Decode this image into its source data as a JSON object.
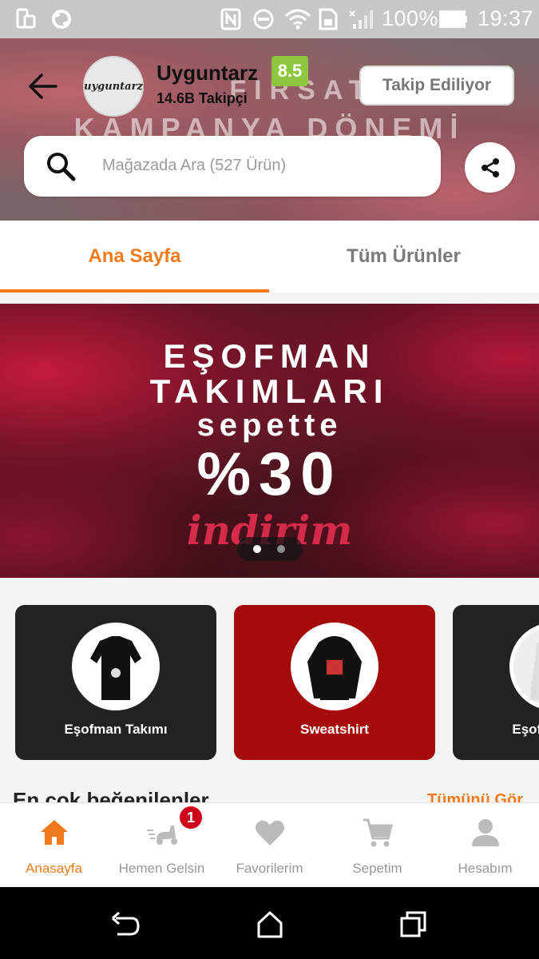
{
  "status_bar": {
    "battery": "100%",
    "time": "19:37"
  },
  "store": {
    "name": "Uyguntarz",
    "logo_text": "uyguntarz",
    "rating": "8.5",
    "followers": "14.6B Takipçi",
    "follow_button": "Takip Ediliyor",
    "banner_line1": "FIRSAT",
    "banner_line2": "KAMPANYA DÖNEMİ",
    "search_placeholder": "Mağazada Ara (527 Ürün)"
  },
  "tabs": [
    {
      "label": "Ana Sayfa",
      "active": true
    },
    {
      "label": "Tüm Ürünler",
      "active": false
    }
  ],
  "promo": {
    "line1": "EŞOFMAN",
    "line2": "TAKIMLARI",
    "line3": "sepette",
    "line4": "%30",
    "line5": "indirim",
    "slide_count": 2,
    "active_slide": 1
  },
  "categories": [
    {
      "label": "Eşofman Takımı",
      "bg": "#222222"
    },
    {
      "label": "Sweatshirt",
      "bg": "#a50b0b"
    },
    {
      "label": "Eşofman Altı",
      "bg": "#222222"
    }
  ],
  "section": {
    "title": "En çok beğenilenler",
    "link": "Tümünü Gör"
  },
  "bottom_nav": [
    {
      "label": "Anasayfa",
      "icon": "home-icon",
      "active": true
    },
    {
      "label": "Hemen Gelsin",
      "icon": "scooter-icon",
      "badge": "1"
    },
    {
      "label": "Favorilerim",
      "icon": "heart-icon"
    },
    {
      "label": "Sepetim",
      "icon": "cart-icon"
    },
    {
      "label": "Hesabım",
      "icon": "user-icon"
    }
  ],
  "colors": {
    "accent": "#f27a1a",
    "rating": "#8dc63f",
    "badge": "#d0021b"
  }
}
